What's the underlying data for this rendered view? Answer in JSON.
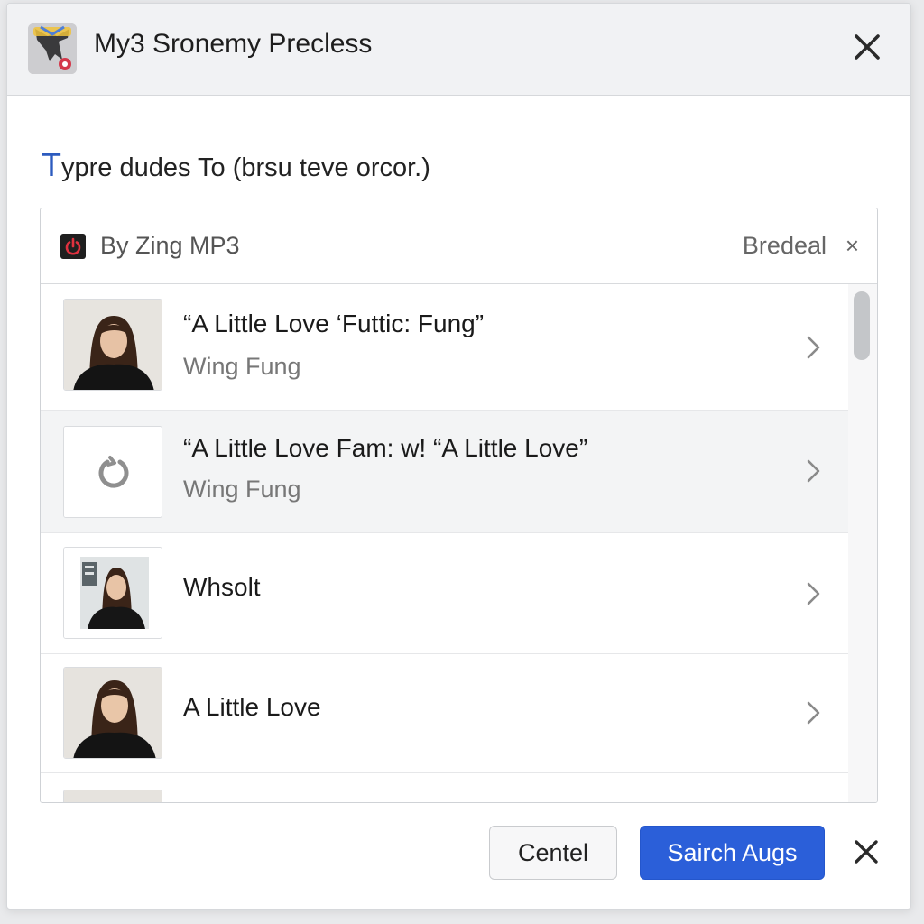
{
  "titlebar": {
    "app_icon": "app-logo-icon",
    "title": "My3 Sronemy Precless",
    "close_icon": "close-icon"
  },
  "instruction": {
    "lead_letter": "T",
    "text": "ypre dudes To (brsu teve orcor.)"
  },
  "panel": {
    "source_icon": "power-icon",
    "source_label": "By Zing MP3",
    "action_label": "Bredeal",
    "clear_icon": "×"
  },
  "results": [
    {
      "title": "“A Little Love ‘Futtic: Fung”",
      "subtitle": "Wing Fung",
      "thumb": "portrait",
      "active": false
    },
    {
      "title": "“A Little Love Fam: w! “A Little Love”",
      "subtitle": "Wing Fung",
      "thumb": "loading-icon",
      "active": true
    },
    {
      "title": "Whsolt",
      "subtitle": "",
      "thumb": "portrait",
      "active": false
    },
    {
      "title": "A Little Love",
      "subtitle": "",
      "thumb": "portrait",
      "active": false
    }
  ],
  "footer": {
    "cancel_label": "Centel",
    "primary_label": "Sairch Augs",
    "close_icon": "close-icon"
  },
  "colors": {
    "accent": "#2b5fd9",
    "title_bar": "#f1f2f4"
  }
}
